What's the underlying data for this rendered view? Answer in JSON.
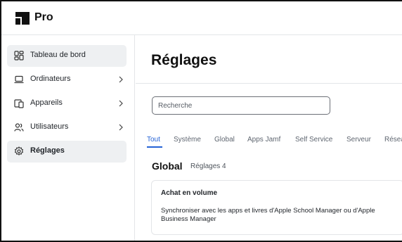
{
  "header": {
    "app_name": "Pro"
  },
  "sidebar": {
    "items": [
      {
        "label": "Tableau de bord",
        "icon": "dashboard-icon",
        "active": true,
        "chevron": false
      },
      {
        "label": "Ordinateurs",
        "icon": "laptop-icon",
        "active": false,
        "chevron": true
      },
      {
        "label": "Appareils",
        "icon": "devices-icon",
        "active": false,
        "chevron": true
      },
      {
        "label": "Utilisateurs",
        "icon": "users-icon",
        "active": false,
        "chevron": true
      },
      {
        "label": "Réglages",
        "icon": "gear-icon",
        "active": true,
        "chevron": false
      }
    ]
  },
  "main": {
    "title": "Réglages",
    "search": {
      "placeholder": "Recherche",
      "value": ""
    },
    "tabs": [
      {
        "label": "Tout",
        "active": true
      },
      {
        "label": "Système",
        "active": false
      },
      {
        "label": "Global",
        "active": false
      },
      {
        "label": "Apps Jamf",
        "active": false
      },
      {
        "label": "Self Service",
        "active": false
      },
      {
        "label": "Serveur",
        "active": false
      },
      {
        "label": "Résea",
        "active": false
      }
    ],
    "section": {
      "title": "Global",
      "subtitle": "Réglages 4"
    },
    "card": {
      "title": "Achat en volume",
      "description": "Synchroniser avec les apps et livres d'Apple School Manager ou d'Apple Business Manager"
    }
  },
  "colors": {
    "accent": "#2563d6",
    "active_bg": "#eef0f2",
    "border": "#e3e5e8"
  }
}
